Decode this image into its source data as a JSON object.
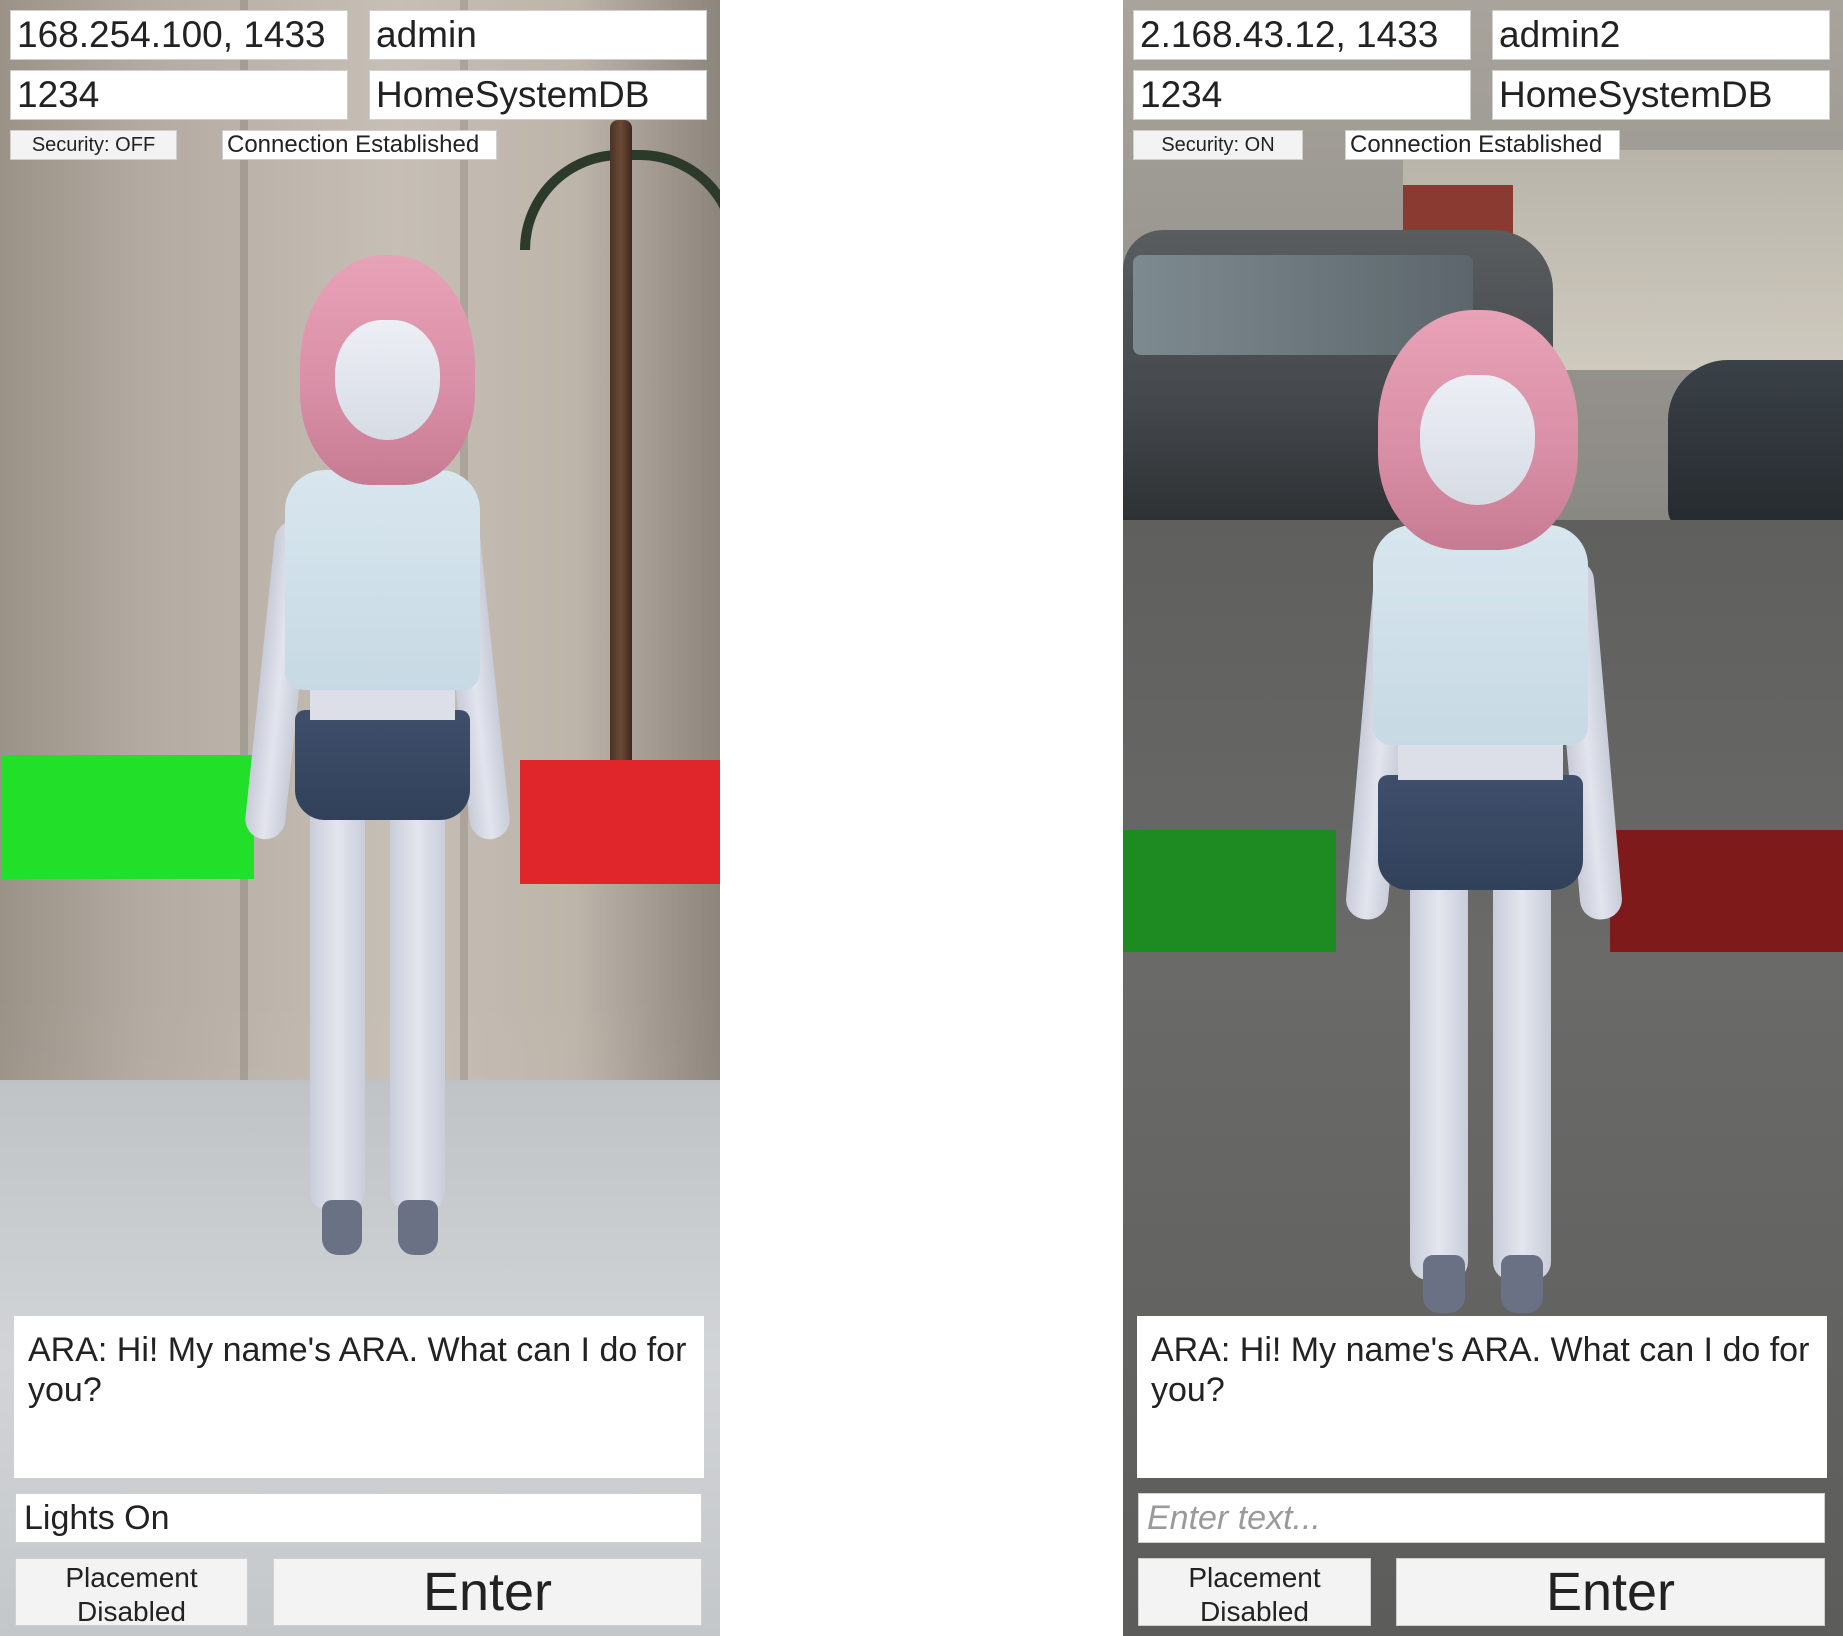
{
  "left": {
    "server_field": "168.254.100, 1433",
    "user_field": "admin",
    "password_field": "1234",
    "database_field": "HomeSystemDB",
    "security_button": "Security: OFF",
    "connection_status": "Connection Established",
    "chat_log": "ARA: Hi! My name's ARA. What can I do for you?",
    "text_input_value": "Lights On",
    "placement_button": "Placement Disabled",
    "enter_button": "Enter",
    "colors": {
      "green_panel": "#22e02a",
      "red_panel": "#e0262a"
    }
  },
  "right": {
    "server_field": "2.168.43.12, 1433",
    "user_field": "admin2",
    "password_field": "1234",
    "database_field": "HomeSystemDB",
    "security_button": "Security: ON",
    "connection_status": "Connection Established",
    "chat_log": "ARA: Hi! My name's ARA. What can I do for you?",
    "text_input_placeholder": "Enter text...",
    "placement_button": "Placement Disabled",
    "enter_button": "Enter",
    "colors": {
      "green_panel": "#1e8a22",
      "red_panel": "#7e1a1a"
    }
  }
}
